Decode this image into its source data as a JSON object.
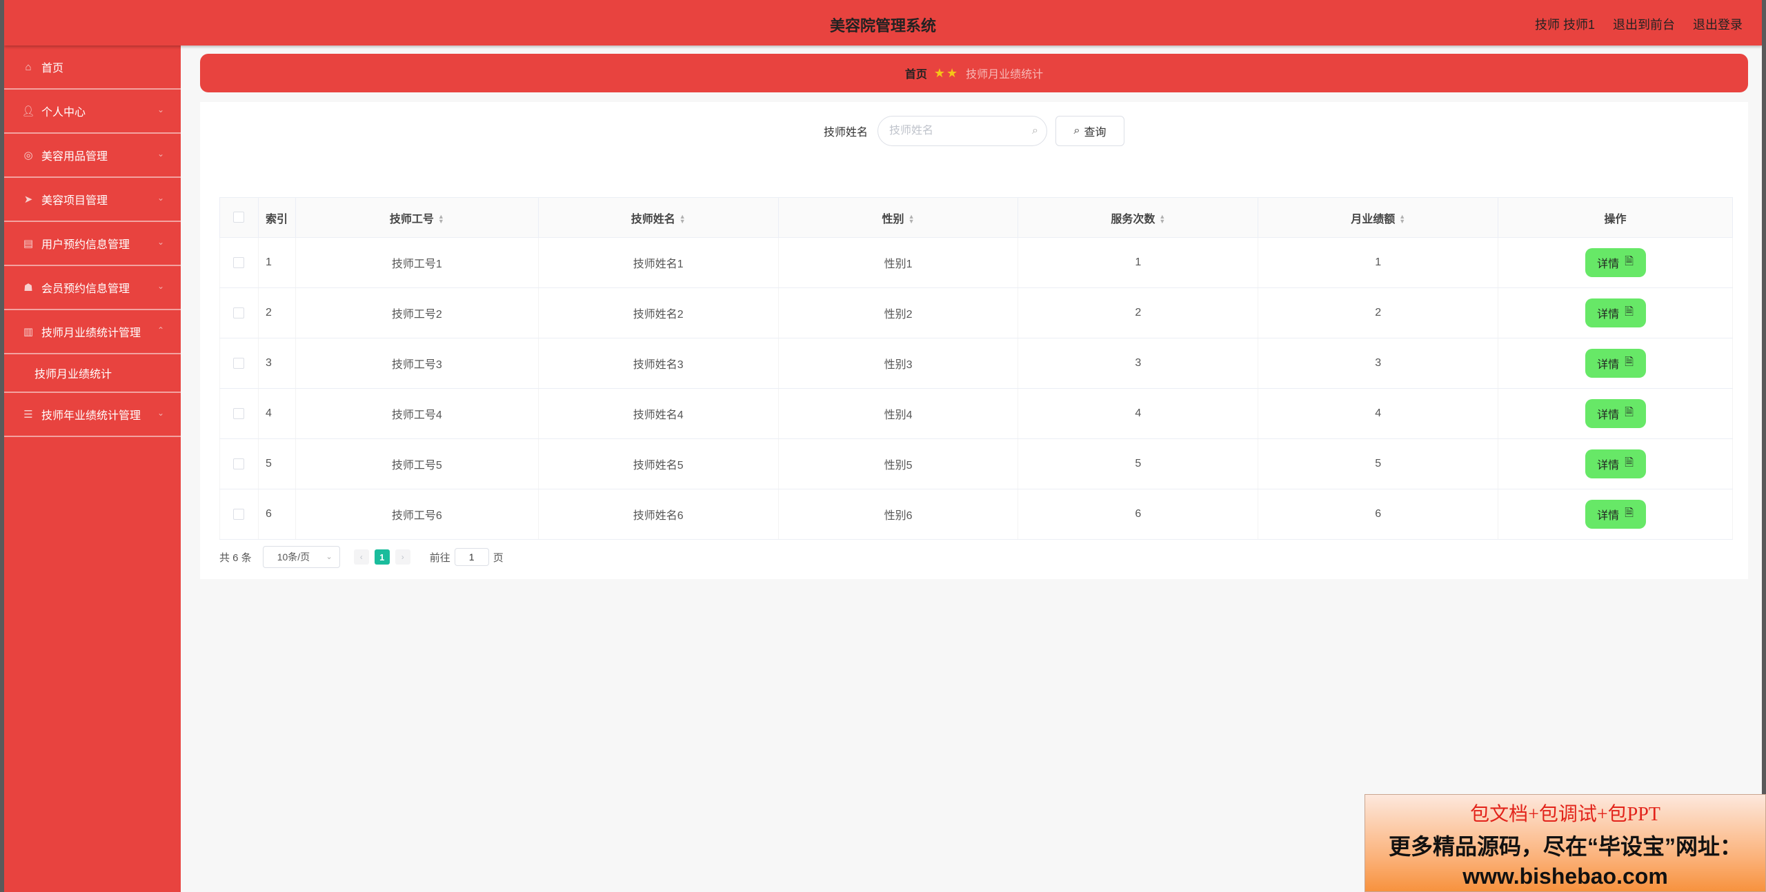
{
  "header": {
    "title": "美容院管理系统",
    "links": [
      "技师 技师1",
      "退出到前台",
      "退出登录"
    ]
  },
  "sidebar": {
    "items": [
      {
        "label": "首页",
        "icon": "home-icon"
      },
      {
        "label": "个人中心",
        "icon": "user-icon"
      },
      {
        "label": "美容用品管理",
        "icon": "compass-icon"
      },
      {
        "label": "美容项目管理",
        "icon": "send-icon"
      },
      {
        "label": "用户预约信息管理",
        "icon": "clipboard-icon"
      },
      {
        "label": "会员预约信息管理",
        "icon": "cup-icon"
      },
      {
        "label": "技师月业绩统计管理",
        "icon": "bar-chart-icon"
      },
      {
        "label": "技师年业绩统计管理",
        "icon": "list-icon"
      }
    ],
    "submenu": {
      "label": "技师月业绩统计"
    }
  },
  "breadcrumb": {
    "home": "首页",
    "current": "技师月业绩统计"
  },
  "search": {
    "label": "技师姓名",
    "placeholder": "技师姓名",
    "value": "",
    "button": "查询"
  },
  "table": {
    "columns": [
      "索引",
      "技师工号",
      "技师姓名",
      "性别",
      "服务次数",
      "月业绩额",
      "操作"
    ],
    "rows": [
      {
        "index": "1",
        "id": "技师工号1",
        "name": "技师姓名1",
        "gender": "性别1",
        "count": "1",
        "amount": "1"
      },
      {
        "index": "2",
        "id": "技师工号2",
        "name": "技师姓名2",
        "gender": "性别2",
        "count": "2",
        "amount": "2"
      },
      {
        "index": "3",
        "id": "技师工号3",
        "name": "技师姓名3",
        "gender": "性别3",
        "count": "3",
        "amount": "3"
      },
      {
        "index": "4",
        "id": "技师工号4",
        "name": "技师姓名4",
        "gender": "性别4",
        "count": "4",
        "amount": "4"
      },
      {
        "index": "5",
        "id": "技师工号5",
        "name": "技师姓名5",
        "gender": "性别5",
        "count": "5",
        "amount": "5"
      },
      {
        "index": "6",
        "id": "技师工号6",
        "name": "技师姓名6",
        "gender": "性别6",
        "count": "6",
        "amount": "6"
      }
    ],
    "detail_label": "详情"
  },
  "pagination": {
    "total": "共 6 条",
    "page_size": "10条/页",
    "current_page": "1",
    "goto_prefix": "前往",
    "goto_value": "1",
    "goto_suffix": "页"
  },
  "promo": {
    "line1": "包文档+包调试+包PPT",
    "line2": "更多精品源码，尽在“毕设宝”网址：",
    "line3": "www.bishebao.com"
  },
  "colors": {
    "primary": "#e8433f",
    "detail_button": "#67e867",
    "active_page": "#1abc9c"
  }
}
